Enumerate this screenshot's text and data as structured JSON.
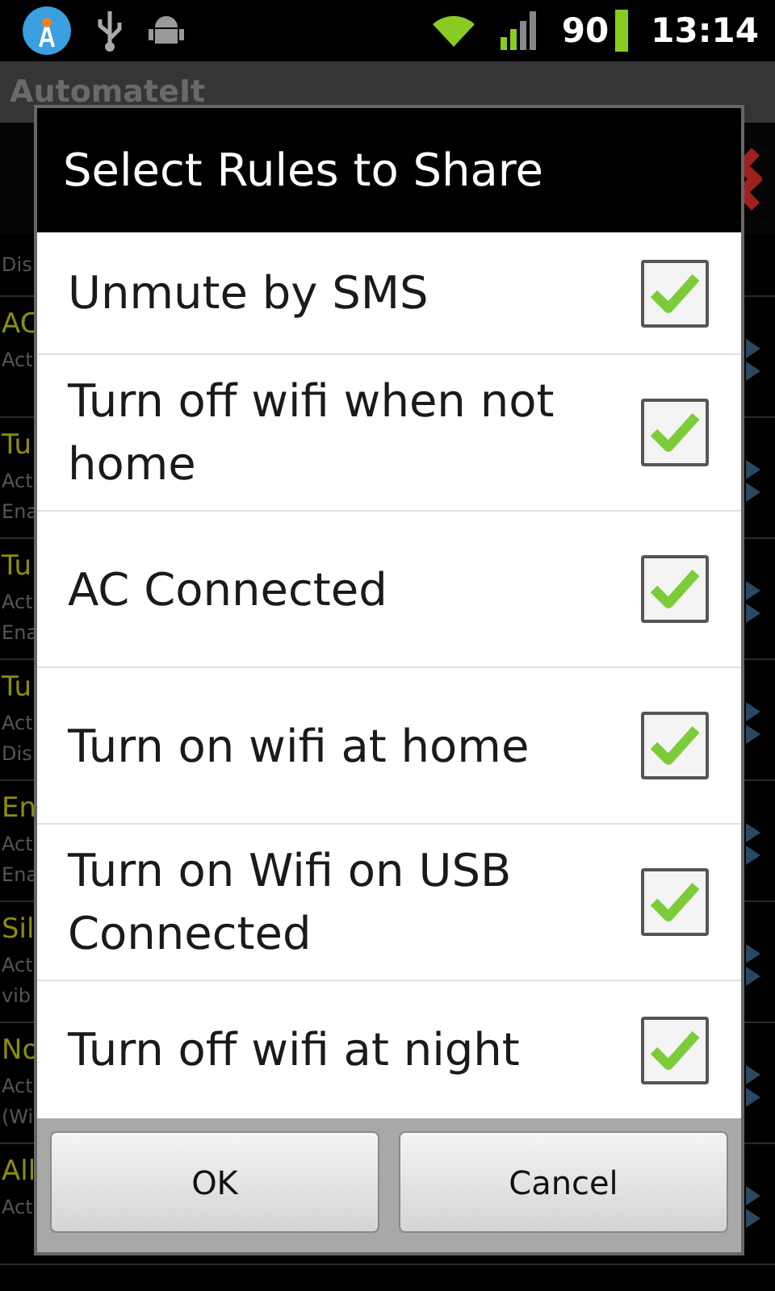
{
  "status_bar": {
    "battery": "90",
    "time": "13:14"
  },
  "app_title": "AutomateIt",
  "background_rules": [
    {
      "details": [
        "Dis"
      ]
    },
    {
      "name": "AC",
      "details": [
        "Act"
      ]
    },
    {
      "name": "Tu",
      "details": [
        "Act",
        "Ena"
      ]
    },
    {
      "name": "Tu",
      "details": [
        "Act",
        "Ena"
      ]
    },
    {
      "name": "Tu",
      "details": [
        "Act",
        "Dis"
      ]
    },
    {
      "name": "En",
      "details": [
        "Act",
        "Ena"
      ]
    },
    {
      "name": "Sil",
      "details": [
        "Act",
        "vib"
      ]
    },
    {
      "name": "No",
      "details": [
        "Act",
        "(Wi"
      ]
    },
    {
      "name": "All",
      "details": [
        "Act"
      ]
    }
  ],
  "dialog": {
    "title": "Select Rules to Share",
    "rules": [
      {
        "label": "Unmute by SMS",
        "checked": true
      },
      {
        "label": "Turn off wifi when not home",
        "checked": true
      },
      {
        "label": "AC Connected",
        "checked": true
      },
      {
        "label": "Turn on wifi at home",
        "checked": true
      },
      {
        "label": "Turn on Wifi on USB Connected",
        "checked": true
      },
      {
        "label": "Turn off wifi at night",
        "checked": true
      }
    ],
    "buttons": [
      "OK",
      "Cancel"
    ]
  }
}
